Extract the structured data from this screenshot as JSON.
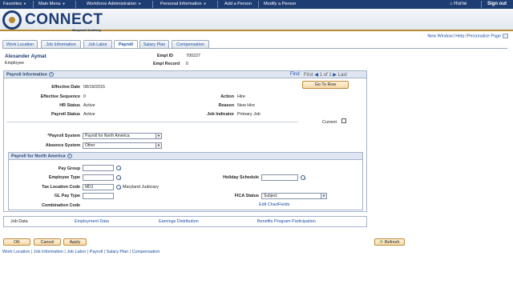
{
  "topnav": {
    "favorites": "Favorites",
    "main_menu": "Main Menu",
    "workforce_admin": "Workforce Administration",
    "personal_info": "Personal Information",
    "add_person": "Add a Person",
    "modify_person": "Modify a Person",
    "home": "Home",
    "sign_out": "Sign out"
  },
  "banner": {
    "logo": "CONNECT",
    "subtitle": "Maryland Judiciary"
  },
  "header_links": {
    "new_window": "New Window",
    "help": "Help",
    "personalize": "Personalize Page"
  },
  "tabs": [
    {
      "label": "Work Location"
    },
    {
      "label": "Job Information"
    },
    {
      "label": "Job Labor"
    },
    {
      "label": "Payroll"
    },
    {
      "label": "Salary Plan"
    },
    {
      "label": "Compensation"
    }
  ],
  "employee": {
    "name": "Alexander Aymat",
    "type": "Employee",
    "empl_id_label": "Empl ID",
    "empl_id": "700227",
    "empl_record_label": "Empl Record",
    "empl_record": "0"
  },
  "payroll_info": {
    "title": "Payroll Information",
    "find": "Find",
    "first": "First",
    "position": "1 of 1",
    "last": "Last",
    "go_to_row": "Go To Row",
    "effective_date_label": "Effective Date",
    "effective_date": "08/19/2015",
    "effective_sequence_label": "Effective Sequence",
    "effective_sequence": "0",
    "hr_status_label": "HR Status",
    "hr_status": "Active",
    "payroll_status_label": "Payroll Status",
    "payroll_status": "Active",
    "action_label": "Action",
    "action": "Hire",
    "reason_label": "Reason",
    "reason": "New Hire",
    "job_indicator_label": "Job Indicator",
    "job_indicator": "Primary Job",
    "current_label": "Current",
    "payroll_system_label": "*Payroll System",
    "payroll_system": "Payroll for North America",
    "absence_system_label": "Absence System",
    "absence_system": "Other"
  },
  "pna": {
    "title": "Payroll for North America",
    "pay_group_label": "Pay Group",
    "pay_group": "",
    "employee_type_label": "Employee Type",
    "employee_type": "",
    "tax_location_label": "Tax Location Code",
    "tax_location": "MDJ",
    "tax_location_desc": "Maryland Judiciary",
    "gl_pay_type_label": "GL Pay Type",
    "gl_pay_type": "",
    "combination_code_label": "Combination Code",
    "holiday_schedule_label": "Holiday Schedule",
    "holiday_schedule": "",
    "fica_status_label": "FICA Status",
    "fica_status": "Subject",
    "edit_chartfields": "Edit ChartFields"
  },
  "sub_links": {
    "job_data": "Job Data",
    "employment_data": "Employment Data",
    "earnings_distribution": "Earnings Distribution",
    "benefits": "Benefits Program Participation"
  },
  "buttons": {
    "ok": "OK",
    "cancel": "Cancel",
    "apply": "Apply",
    "refresh": "Refresh"
  },
  "footer_links": [
    "Work Location",
    "Job Information",
    "Job Labor",
    "Payroll",
    "Salary Plan",
    "Compensation"
  ]
}
